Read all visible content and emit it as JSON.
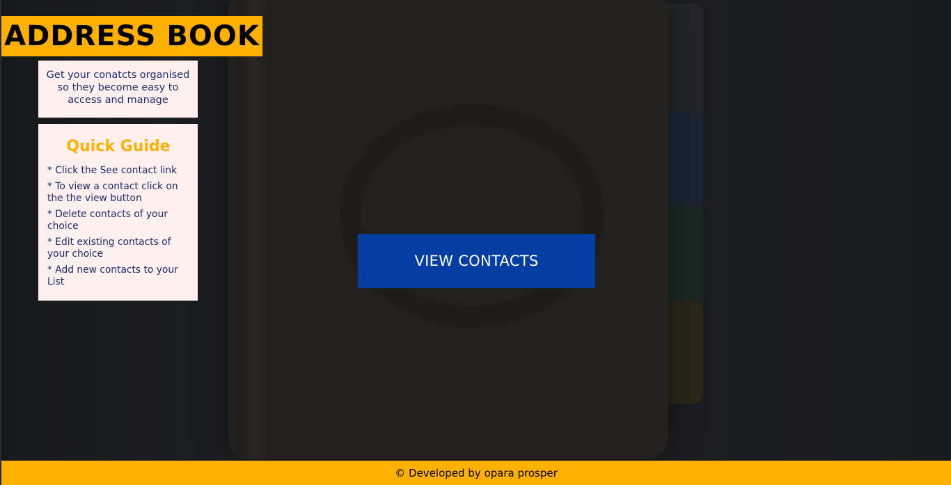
{
  "header": {
    "title": "ADDRESS BOOK"
  },
  "intro": {
    "text": "Get your conatcts organised so they become easy to access and manage"
  },
  "guide": {
    "title": "Quick Guide",
    "items": [
      "* Click the See contact link",
      "* To view a contact click on the the view button",
      "* Delete contacts of your choice",
      "* Edit existing contacts of your choice",
      "* Add new contacts to your List"
    ]
  },
  "cta": {
    "label": "VIEW CONTACTS"
  },
  "footer": {
    "text": "© Developed by opara prosper"
  },
  "colors": {
    "accent": "#ffb000",
    "button": "#053ea3",
    "panel_bg": "#fff0f0",
    "text_dark_blue": "#1f2a6d"
  }
}
